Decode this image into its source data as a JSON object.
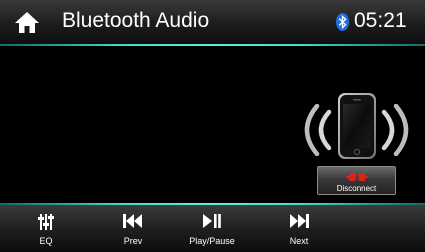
{
  "header": {
    "title": "Bluetooth Audio",
    "clock": "05:21",
    "home_icon": "home-icon",
    "status_icon": "bluetooth-icon"
  },
  "device": {
    "icon": "phone-icon",
    "disconnect_label": "Disconnect",
    "disconnect_icon": "unplug-icon"
  },
  "controls": [
    {
      "label": "EQ",
      "icon": "equalizer-icon"
    },
    {
      "label": "Prev",
      "icon": "skip-previous-icon"
    },
    {
      "label": "Play/Pause",
      "icon": "play-pause-icon"
    },
    {
      "label": "Next",
      "icon": "skip-next-icon"
    }
  ],
  "colors": {
    "accent_line": "#43e0c8",
    "bluetooth": "#1f6fe0",
    "disconnect_plug": "#e0201a"
  }
}
